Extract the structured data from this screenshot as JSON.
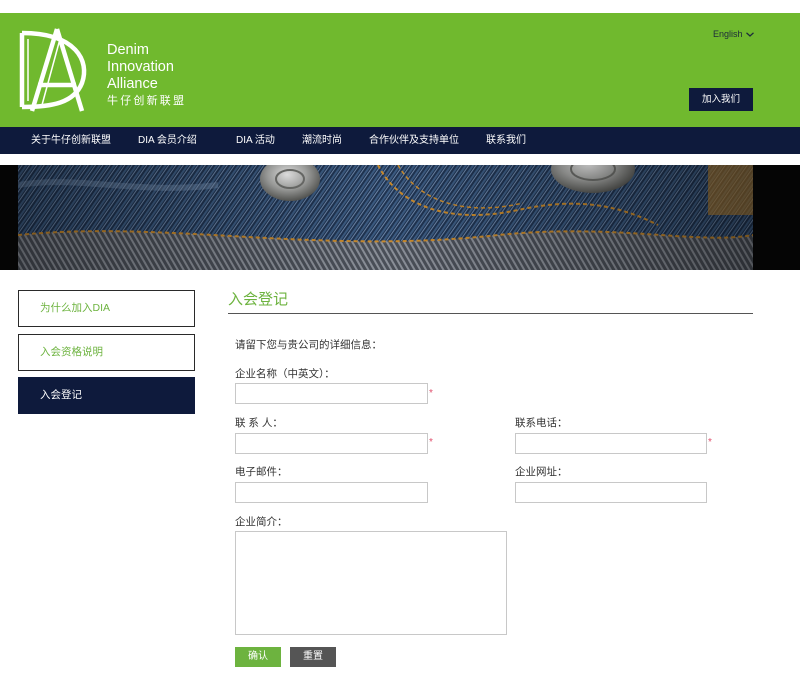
{
  "brand": {
    "name_line1": "Denim",
    "name_line2": "Innovation",
    "name_line3": "Alliance",
    "name_cn": "牛仔创新联盟"
  },
  "header": {
    "language": "English",
    "join_button": "加入我们"
  },
  "nav": {
    "items": [
      {
        "label": "关于牛仔创新联盟"
      },
      {
        "label": "DIA 会员介绍"
      },
      {
        "label": "DIA 活动"
      },
      {
        "label": "潮流时尚"
      },
      {
        "label": "合作伙伴及支持单位"
      },
      {
        "label": "联系我们"
      }
    ]
  },
  "sidebar": {
    "items": [
      {
        "label": "为什么加入DIA",
        "active": false
      },
      {
        "label": "入会资格说明",
        "active": false
      },
      {
        "label": "入会登记",
        "active": true
      }
    ]
  },
  "main": {
    "title": "入会登记",
    "intro": "请留下您与贵公司的详细信息：",
    "fields": {
      "company_name": {
        "label": "企业名称（中英文）：",
        "value": "",
        "required": true
      },
      "contact": {
        "label": "联 系 人：",
        "value": "",
        "required": true
      },
      "phone": {
        "label": "联系电话：",
        "value": "",
        "required": true
      },
      "email": {
        "label": "电子邮件：",
        "value": ""
      },
      "website": {
        "label": "企业网址：",
        "value": ""
      },
      "intro_text": {
        "label": "企业简介：",
        "value": ""
      }
    },
    "required_mark": "*",
    "confirm_button": "确认",
    "reset_button": "重置"
  },
  "colors": {
    "brand_green": "#70b92e",
    "navy": "#0e1a3c",
    "accent_green_text": "#6db33f",
    "required_red": "#e0506e"
  }
}
